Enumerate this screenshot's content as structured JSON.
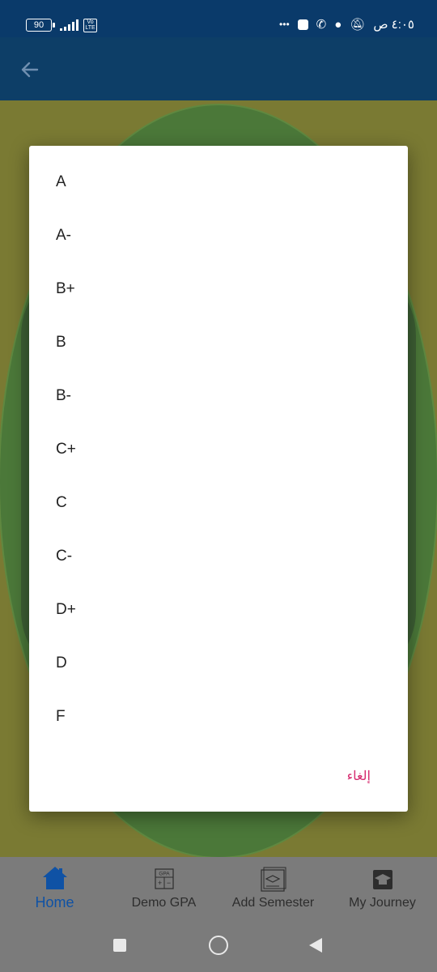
{
  "status_bar": {
    "battery": "90",
    "network_badge": "Vo LTE",
    "time": "٤:٠٥ ص",
    "overflow_dots": "•••"
  },
  "dialog": {
    "options": [
      "A",
      "A-",
      "B+",
      "B",
      "B-",
      "C+",
      "C",
      "C-",
      "D+",
      "D",
      "F"
    ],
    "cancel_label": "إلغاء"
  },
  "bottom_nav": {
    "items": [
      {
        "label": "Home",
        "icon": "home-icon"
      },
      {
        "label": "Demo GPA",
        "icon": "calculator-icon"
      },
      {
        "label": "Add Semester",
        "icon": "add-semester-icon"
      },
      {
        "label": "My Journey",
        "icon": "graduation-icon"
      }
    ],
    "calculator_icon_text": "GPA"
  },
  "colors": {
    "accent": "#d62b6e",
    "app_bar": "#0d3e67",
    "active_nav": "#0f52a5"
  }
}
